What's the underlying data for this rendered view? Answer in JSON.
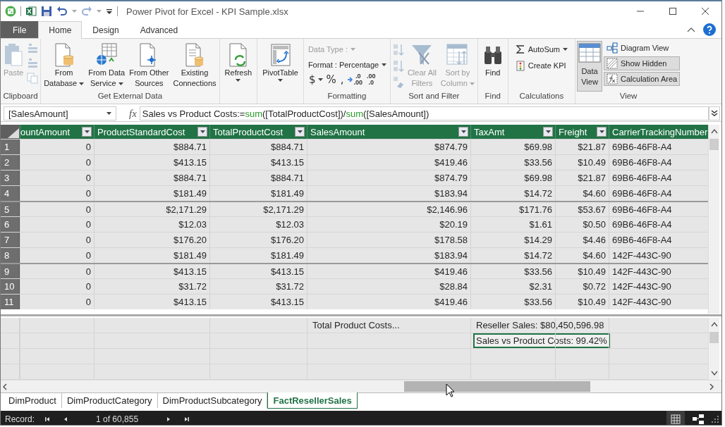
{
  "window": {
    "title": "Power Pivot for Excel - KPI Sample.xlsx"
  },
  "tabs": [
    {
      "label": "File",
      "kind": "file",
      "selected": false
    },
    {
      "label": "Home",
      "kind": "tab",
      "selected": true
    },
    {
      "label": "Design",
      "kind": "tab",
      "selected": false
    },
    {
      "label": "Advanced",
      "kind": "tab",
      "selected": false
    }
  ],
  "ribbon": {
    "clipboard": {
      "label": "Clipboard",
      "paste": {
        "label": "Paste",
        "disabled": true
      },
      "small_buttons": [
        {
          "disabled": true
        },
        {
          "disabled": true
        },
        {
          "disabled": true
        }
      ]
    },
    "get_external_data": {
      "label": "Get External Data",
      "buttons": [
        {
          "lines": [
            "From",
            "Database"
          ],
          "dropdown": true
        },
        {
          "lines": [
            "From Data",
            "Service"
          ],
          "dropdown": true
        },
        {
          "lines": [
            "From Other",
            "Sources"
          ],
          "dropdown": false
        },
        {
          "lines": [
            "Existing",
            "Connections"
          ],
          "dropdown": false
        }
      ]
    },
    "refresh": {
      "label": "Refresh",
      "dropdown": true
    },
    "pivot_table": {
      "label": "PivotTable",
      "dropdown": true
    },
    "formatting": {
      "label": "Formatting",
      "data_type": {
        "label": "Data Type :",
        "disabled": true
      },
      "format": {
        "label": "Format : Percentage",
        "disabled": false
      },
      "currency": "$",
      "percent": "%",
      "comma": ",",
      "increase_decimals": {
        "top": ".0",
        "bottom": ".00"
      },
      "decrease_decimals": {
        "top": ".00",
        "bottom": ".0"
      }
    },
    "sort_and_filter": {
      "label": "Sort and Filter",
      "sort_buttons": [
        {
          "disabled": true
        },
        {
          "disabled": true
        },
        {
          "disabled": true
        }
      ],
      "clear_filters": {
        "lines": [
          "Clear All",
          "Filters"
        ],
        "disabled": true
      },
      "sort_by_column": {
        "lines": [
          "Sort by",
          "Column"
        ],
        "disabled": true,
        "dropdown": true
      }
    },
    "find": {
      "label": "Find",
      "button": "Find"
    },
    "calculations": {
      "label": "Calculations",
      "autosum": {
        "label": "AutoSum",
        "dropdown": true
      },
      "create_kpi": {
        "label": "Create KPI"
      }
    },
    "view": {
      "label": "View",
      "data_view": {
        "lines": [
          "Data",
          "View"
        ],
        "selected": true
      },
      "toggles": [
        {
          "label": "Diagram View",
          "selected": false
        },
        {
          "label": "Show Hidden",
          "selected": true
        },
        {
          "label": "Calculation Area",
          "selected": true
        }
      ]
    }
  },
  "formula_bar": {
    "name_box": "[SalesAmount]",
    "fx": "fx",
    "formula": [
      {
        "text": "Sales vs Product Costs:=",
        "kind": "plain"
      },
      {
        "text": "sum",
        "kind": "function"
      },
      {
        "text": "([TotalProductCost])/",
        "kind": "plain"
      },
      {
        "text": "sum",
        "kind": "function"
      },
      {
        "text": "([SalesAmount])",
        "kind": "plain"
      }
    ]
  },
  "table": {
    "columns": [
      {
        "label": "ountAmount",
        "kind": "number"
      },
      {
        "label": "ProductStandardCost",
        "kind": "number"
      },
      {
        "label": "TotalProductCost",
        "kind": "number"
      },
      {
        "label": "SalesAmount",
        "kind": "number"
      },
      {
        "label": "TaxAmt",
        "kind": "number"
      },
      {
        "label": "Freight",
        "kind": "number"
      },
      {
        "label": "CarrierTrackingNumber",
        "kind": "text"
      }
    ],
    "rows": [
      {
        "number": "1",
        "group_start": false,
        "cells": [
          "0",
          "$884.71",
          "$884.71",
          "$874.79",
          "$69.98",
          "$21.87",
          "69B6-46F8-A4"
        ]
      },
      {
        "number": "2",
        "group_start": false,
        "cells": [
          "0",
          "$413.15",
          "$413.15",
          "$419.46",
          "$33.56",
          "$10.49",
          "69B6-46F8-A4"
        ]
      },
      {
        "number": "3",
        "group_start": false,
        "cells": [
          "0",
          "$884.71",
          "$884.71",
          "$874.79",
          "$69.98",
          "$21.87",
          "69B6-46F8-A4"
        ]
      },
      {
        "number": "4",
        "group_start": false,
        "cells": [
          "0",
          "$181.49",
          "$181.49",
          "$183.94",
          "$14.72",
          "$4.60",
          "69B6-46F8-A4"
        ]
      },
      {
        "number": "5",
        "group_start": true,
        "cells": [
          "0",
          "$2,171.29",
          "$2,171.29",
          "$2,146.96",
          "$171.76",
          "$53.67",
          "69B6-46F8-A4"
        ]
      },
      {
        "number": "6",
        "group_start": false,
        "cells": [
          "0",
          "$12.03",
          "$12.03",
          "$20.19",
          "$1.61",
          "$0.50",
          "69B6-46F8-A4"
        ]
      },
      {
        "number": "7",
        "group_start": false,
        "cells": [
          "0",
          "$176.20",
          "$176.20",
          "$178.58",
          "$14.29",
          "$4.46",
          "69B6-46F8-A4"
        ]
      },
      {
        "number": "8",
        "group_start": false,
        "cells": [
          "0",
          "$181.49",
          "$181.49",
          "$183.94",
          "$14.72",
          "$4.60",
          "142F-443C-90"
        ]
      },
      {
        "number": "9",
        "group_start": true,
        "cells": [
          "0",
          "$413.15",
          "$413.15",
          "$419.46",
          "$33.56",
          "$10.49",
          "142F-443C-90"
        ]
      },
      {
        "number": "10",
        "group_start": false,
        "cells": [
          "0",
          "$31.72",
          "$31.72",
          "$28.84",
          "$2.31",
          "$0.72",
          "142F-443C-90"
        ]
      },
      {
        "number": "11",
        "group_start": false,
        "cells": [
          "0",
          "$413.15",
          "$413.15",
          "$419.46",
          "$33.56",
          "$10.49",
          "142F-443C-90"
        ]
      }
    ]
  },
  "calculation_area": {
    "measures": [
      {
        "text": "Total Product Costs...",
        "selected": false
      },
      {
        "text": "Reseller Sales: $80,450,596.98",
        "selected": false
      },
      {
        "text": "Sales vs Product Costs: 99.42%",
        "selected": true
      }
    ]
  },
  "sheet_tabs": [
    {
      "label": "DimProduct",
      "selected": false
    },
    {
      "label": "DimProductCategory",
      "selected": false
    },
    {
      "label": "DimProductSubcategory",
      "selected": false
    },
    {
      "label": "FactResellerSales",
      "selected": true
    }
  ],
  "status_bar": {
    "record_label": "Record:",
    "position": "1 of 60,855",
    "views": [
      {
        "kind": "grid",
        "selected": true
      },
      {
        "kind": "diagram",
        "selected": false
      }
    ]
  }
}
